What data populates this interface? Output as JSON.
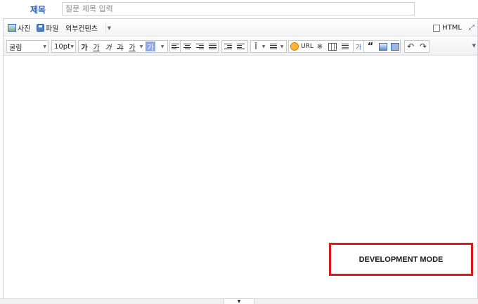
{
  "title_field": {
    "label": "제목",
    "placeholder": "질문 제목 입력",
    "value": ""
  },
  "attach_toolbar": {
    "photo_label": "사진",
    "file_label": "파일",
    "external_label": "외부컨텐츠",
    "html_label": "HTML",
    "html_checked": false
  },
  "format_toolbar": {
    "font_family": "굴림",
    "font_size": "10pt",
    "bold_label": "가",
    "underline_label": "가",
    "italic_label": "가",
    "strike_label": "가",
    "font_color_label": "가",
    "bg_color_label": "가",
    "url_label": "URL",
    "special_char_label": "※",
    "quote_label": "“"
  },
  "content": {
    "overlay_text": "DEVELOPMENT MODE"
  },
  "colors": {
    "title_label": "#2f5fb3",
    "overlay_border": "#e01818"
  }
}
